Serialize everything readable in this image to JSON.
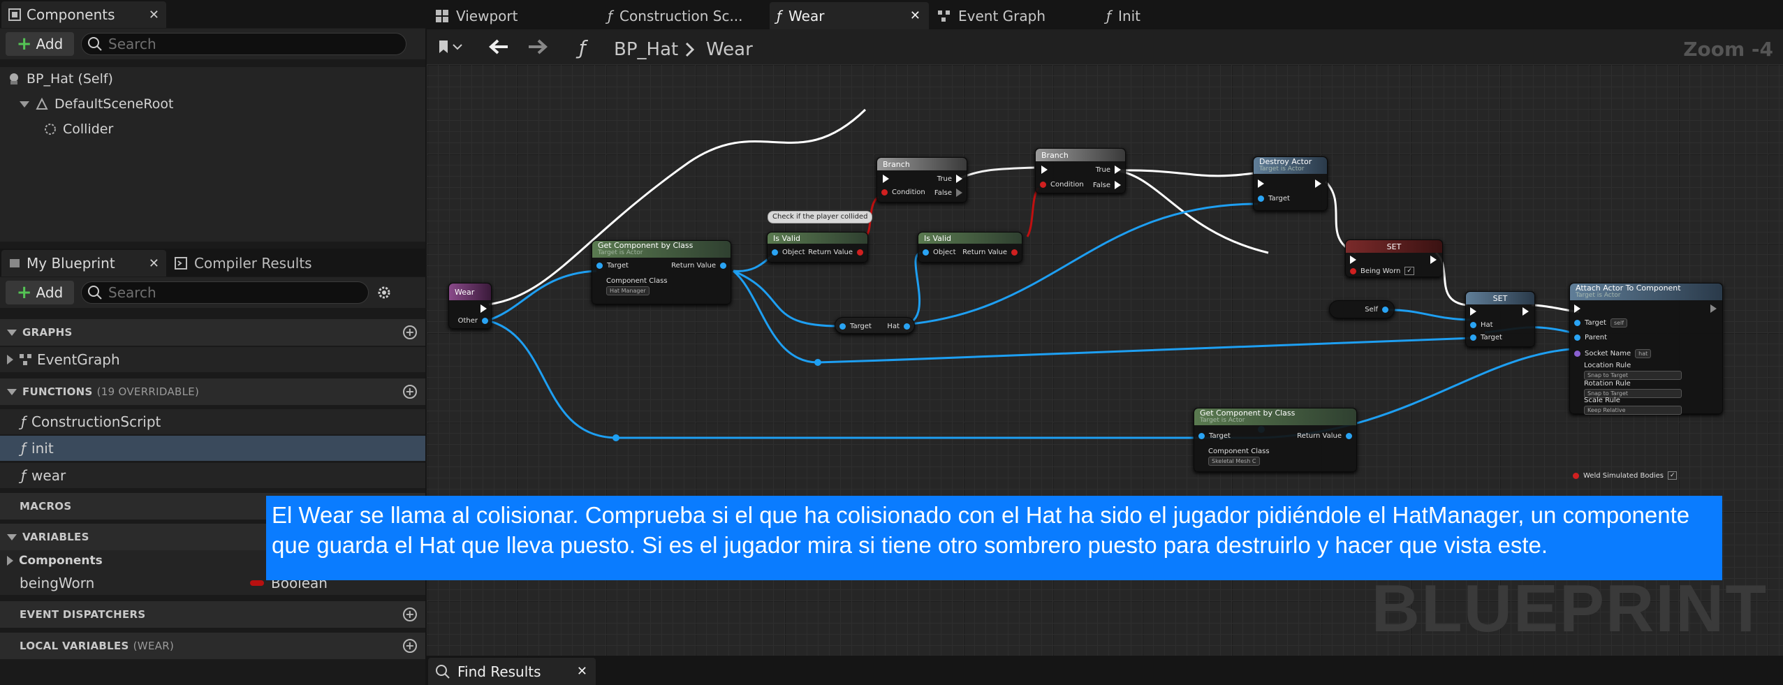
{
  "components_panel": {
    "tab_label": "Components",
    "add_label": "Add",
    "search_placeholder": "Search",
    "tree": [
      "BP_Hat (Self)",
      "DefaultSceneRoot",
      "Collider"
    ]
  },
  "my_blueprint": {
    "tab_label": "My Blueprint",
    "compiler_tab_label": "Compiler Results",
    "add_label": "Add",
    "search_placeholder": "Search",
    "graphs_header": "GRAPHS",
    "event_graph": "EventGraph",
    "functions_header": "FUNCTIONS",
    "functions_sub": "(19 OVERRIDABLE)",
    "functions": [
      "ConstructionScript",
      "init",
      "wear"
    ],
    "selected_function": "init",
    "macros_header": "MACROS",
    "variables_header": "VARIABLES",
    "components_category": "Components",
    "variable_name": "beingWorn",
    "variable_type": "Boolean",
    "event_dispatchers_header": "EVENT DISPATCHERS",
    "local_variables_header": "LOCAL VARIABLES",
    "local_variables_sub": "(WEAR)"
  },
  "graph_tabs": [
    "Viewport",
    "Construction Sc...",
    "Wear",
    "Event Graph",
    "Init"
  ],
  "active_graph_tab": "Wear",
  "breadcrumb": {
    "blueprint": "BP_Hat",
    "function": "Wear"
  },
  "zoom_label": "Zoom -4",
  "watermark": "BLUEPRINT",
  "nodes": {
    "wear": {
      "title": "Wear",
      "pin_other": "Other"
    },
    "get_comp1": {
      "title": "Get Component by Class",
      "sub": "Target is Actor",
      "target": "Target",
      "return": "Return Value",
      "comp_class": "Component Class",
      "comp_value": "Hat Manager"
    },
    "comment": "Check if the player collided",
    "isvalid1": {
      "title": "Is Valid",
      "object": "Object",
      "return": "Return Value"
    },
    "branch1": {
      "title": "Branch",
      "true": "True",
      "false": "False",
      "condition": "Condition"
    },
    "hat_getter": {
      "target": "Target",
      "hat": "Hat"
    },
    "isvalid2": {
      "title": "Is Valid",
      "object": "Object",
      "return": "Return Value"
    },
    "branch2": {
      "title": "Branch",
      "true": "True",
      "false": "False",
      "condition": "Condition"
    },
    "destroy": {
      "title": "Destroy Actor",
      "sub": "Target is Actor",
      "target": "Target"
    },
    "set1": {
      "title": "SET",
      "pin": "Being Worn"
    },
    "self_node": "Self",
    "set2": {
      "title": "SET",
      "hat": "Hat",
      "target": "Target"
    },
    "attach": {
      "title": "Attach Actor To Component",
      "sub": "Target is Actor",
      "target": "Target",
      "target_value": "self",
      "parent": "Parent",
      "socket": "Socket Name",
      "socket_value": "hat",
      "loc_rule": "Location Rule",
      "loc_value": "Snap to Target",
      "rot_rule": "Rotation Rule",
      "rot_value": "Snap to Target",
      "scale_rule": "Scale Rule",
      "scale_value": "Keep Relative",
      "weld": "Weld Simulated Bodies"
    },
    "get_comp2": {
      "title": "Get Component by Class",
      "sub": "Target is Actor",
      "target": "Target",
      "return": "Return Value",
      "comp_class": "Component Class",
      "comp_value": "Skeletal Mesh C"
    }
  },
  "caption": "El Wear se llama al colisionar. Comprueba si el que ha colisionado con el Hat ha sido el jugador pidiéndole el HatManager, un componente que guarda el Hat que lleva puesto. Si es el jugador mira si tiene otro sombrero puesto para destruirlo y hacer que vista este.",
  "find_results_label": "Find Results"
}
